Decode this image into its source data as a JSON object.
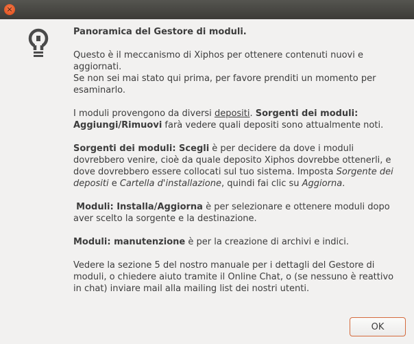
{
  "window": {
    "close_glyph": "×"
  },
  "message": {
    "title": "Panoramica del Gestore di moduli.",
    "p1": {
      "line1": "Questo è il meccanismo di Xiphos per ottenere contenuti nuovi e aggiornati.",
      "line2": "Se non sei mai stato qui prima, per favore prenditi un momento per esaminarlo."
    },
    "p2": {
      "t1": "I moduli provengono da diversi ",
      "link": "depositi",
      "t2": ". ",
      "b1": "Sorgenti dei moduli: Aggiungi/Rimuovi",
      "t3": " farà vedere quali depositi sono attualmente noti."
    },
    "p3": {
      "b1": "Sorgenti dei moduli: Scegli",
      "t1": " è per decidere da dove i moduli dovrebbero venire, cioè da quale deposito Xiphos dovrebbe ottenerli, e dove dovrebbero essere collocati sul tuo sistema. Imposta ",
      "i1": "Sorgente dei depositi",
      "t2": " e ",
      "i2": "Cartella d'installazione",
      "t3": ", quindi fai clic su ",
      "i3": "Aggiorna",
      "t4": "."
    },
    "p4": {
      "b1": "Moduli: Installa/Aggiorna",
      "t1": " è per selezionare e ottenere moduli dopo aver scelto la sorgente e la destinazione."
    },
    "p5": {
      "b1": "Moduli: manutenzione",
      "t1": " è per la creazione di archivi e indici."
    },
    "p6": "Vedere la sezione 5 del nostro manuale per i dettagli del Gestore di moduli, o chiedere aiuto tramite il Online Chat, o (se nessuno è reattivo in chat) inviare mail alla mailing list dei nostri utenti."
  },
  "buttons": {
    "ok_label": "OK"
  },
  "icons": {
    "window_close": "close-icon",
    "info": "lightbulb-icon"
  },
  "colors": {
    "titlebar": "#3c3b37",
    "close_button": "#df4a16",
    "ok_border": "#d46a3c",
    "text": "#3c3c3c"
  }
}
